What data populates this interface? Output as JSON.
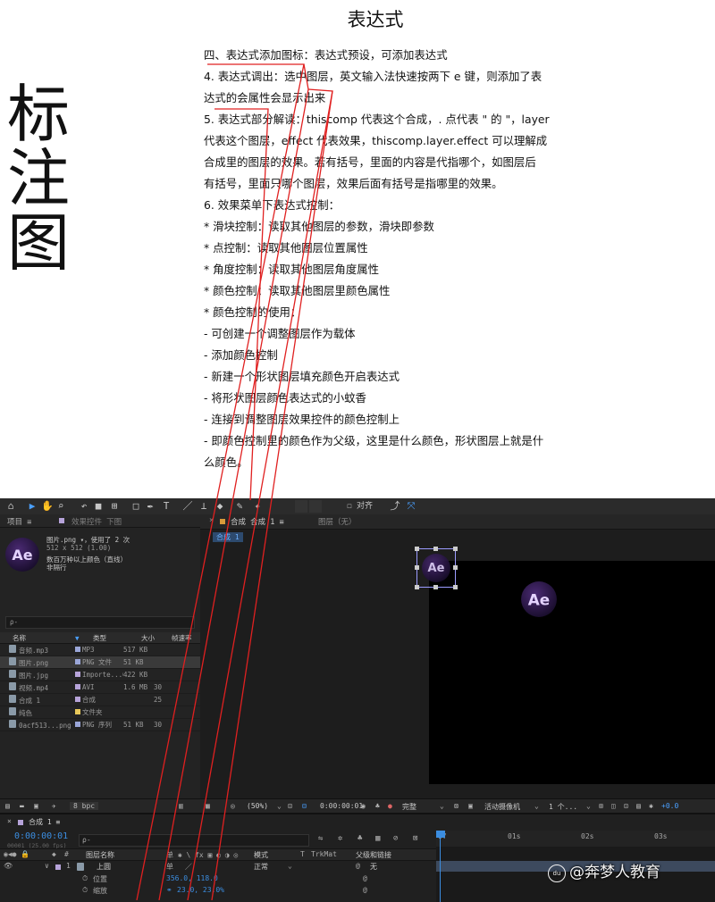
{
  "side_label": [
    "标",
    "注",
    "图"
  ],
  "doc": {
    "title": "表达式",
    "lines": [
      "四、表达式添加图标：表达式预设，可添加表达式",
      "4. 表达式调出：选中图层，英文输入法快速按两下 e 键，则添加了表",
      "达式的会属性会显示出来",
      "5. 表达式部分解读：thiscomp 代表这个合成，. 点代表 \" 的 \"，layer",
      "代表这个图层，effect 代表效果，thiscomp.layer.effect 可以理解成",
      "合成里的图层的效果。若有括号，里面的内容是代指哪个，如图层后",
      "有括号，里面只哪个图层，效果后面有括号是指哪里的效果。",
      "6. 效果菜单下表达式控制：",
      "* 滑块控制：读取其他图层的参数，滑块即参数",
      "* 点控制：读取其他图层位置属性",
      "* 角度控制：读取其他图层角度属性",
      "* 颜色控制：读取其他图层里颜色属性",
      "* 颜色控制的使用：",
      "- 可创建一个调整图层作为载体",
      "- 添加颜色控制",
      "- 新建一个形状图层填充颜色开启表达式",
      "- 将形状图层颜色表达式的小蚊香",
      "- 连接到调整图层效果控件的颜色控制上",
      "- 即颜色控制里的颜色作为父级，这里是什么颜色，形状图层上就是什",
      "么颜色。"
    ]
  },
  "ae": {
    "toolbar": {
      "align_label": "对齐"
    },
    "project": {
      "tab_project": "项目 ≡",
      "tab_effects": "效果控件 下图",
      "preview_name": "图片.png ▾，使用了 2 次",
      "preview_size": "512 x 512 (1.00)",
      "preview_info1": "数百万种以上颜色（直线）",
      "preview_info2": "非隔行",
      "search_placeholder": "ρ-",
      "columns": [
        "名称",
        "类型",
        "大小",
        "帧速率"
      ],
      "rows": [
        {
          "name": "音频.mp3",
          "type": "MP3",
          "size": "517 KB",
          "fps": "",
          "color": "#9aa6d8"
        },
        {
          "name": "图片.png",
          "type": "PNG 文件",
          "size": "51 KB",
          "fps": "",
          "color": "#9aa6d8"
        },
        {
          "name": "图片.jpg",
          "type": "Importe...G",
          "size": "422 KB",
          "fps": "",
          "color": "#b6a3d9"
        },
        {
          "name": "视频.mp4",
          "type": "AVI",
          "size": "1.6 MB",
          "fps": "30",
          "color": "#b6a3d9"
        },
        {
          "name": "合成 1",
          "type": "合成",
          "size": "",
          "fps": "25",
          "color": "#b6a3d9"
        },
        {
          "name": "纯色",
          "type": "文件夹",
          "size": "",
          "fps": "",
          "color": "#e8c85a"
        },
        {
          "name": "0acf513...png",
          "type": "PNG 序列",
          "size": "51 KB",
          "fps": "30",
          "color": "#9aa6d8"
        }
      ],
      "bpc": "8 bpc"
    },
    "viewer": {
      "tab_comp": "合成 合成 1 ≡",
      "tab_layer": "图层（无）",
      "breadcrumb": "合成 1",
      "logo_text": "Ae",
      "zoom": "(50%)",
      "timecode": "0:00:00:01",
      "quality": "完整",
      "camera": "活动摄像机",
      "views": "1 个...",
      "exposure": "+0.0"
    },
    "timeline": {
      "tab": "合成 1 ≡",
      "timecode": "0:00:00:01",
      "frame_info": "00001 (25.00 fps)",
      "search_placeholder": "ρ-",
      "col_layer_name": "图层名称",
      "col_switches": "单 ✱ \\ fx ▣ ◐ ◑ ◎",
      "col_mode": "模式",
      "col_t": "T",
      "col_trkmat": "TrkMat",
      "col_parent": "父级和链接",
      "layer_num": "1",
      "layer_name": "上圆",
      "mode_value": "正常",
      "parent_value": "无",
      "prop1_name": "位置",
      "prop1_value": "356.0, 118.0",
      "prop2_name": "缩放",
      "prop2_value": "23.0, 23.0%",
      "ruler": [
        "0f",
        "01s",
        "02s",
        "03s"
      ]
    }
  },
  "watermark": {
    "badge": "du",
    "text": "@奔梦人教育"
  },
  "colors": {
    "annotation": "#e02020",
    "ae_accent": "#2d8ceb",
    "timecode": "#3b8de0"
  }
}
